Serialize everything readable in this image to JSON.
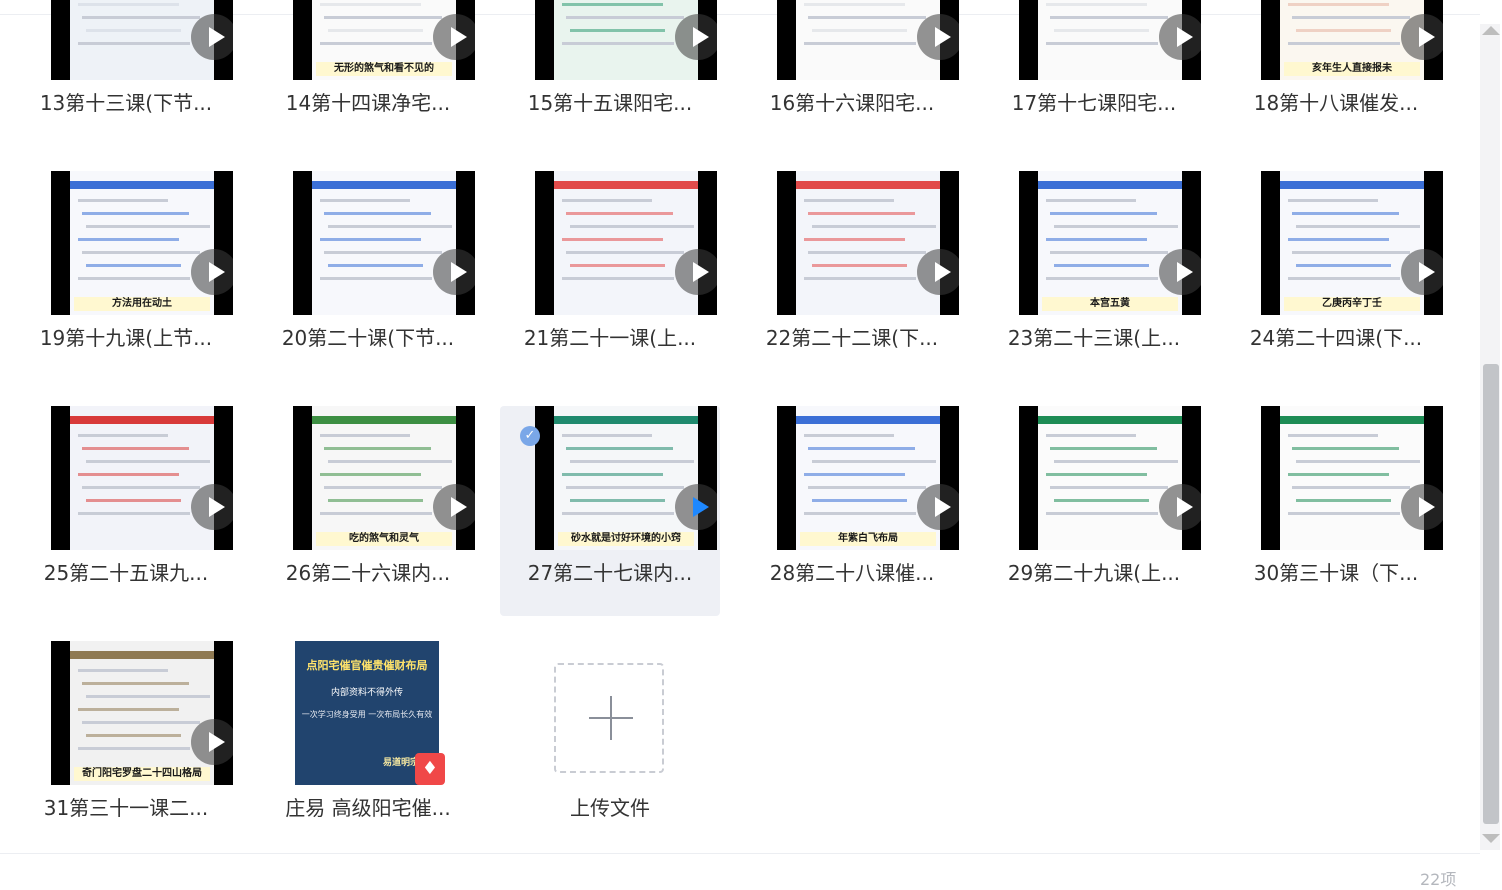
{
  "files": [
    {
      "name": "13第十三课(下节...",
      "type": "video",
      "theme": "table",
      "caption": ""
    },
    {
      "name": "14第十四课净宅...",
      "type": "video",
      "theme": "text",
      "caption": "无形的煞气和看不见的"
    },
    {
      "name": "15第十五课阳宅...",
      "type": "video",
      "theme": "textgreen",
      "caption": ""
    },
    {
      "name": "16第十六课阳宅...",
      "type": "video",
      "theme": "text",
      "caption": ""
    },
    {
      "name": "17第十七课阳宅...",
      "type": "video",
      "theme": "text",
      "caption": ""
    },
    {
      "name": "18第十八课催发...",
      "type": "video",
      "theme": "compass",
      "caption": "亥年生人直接报未"
    },
    {
      "name": "19第十九课(上节...",
      "type": "video",
      "theme": "grid",
      "caption": "方法用在动土"
    },
    {
      "name": "20第二十课(下节...",
      "type": "video",
      "theme": "grid",
      "caption": ""
    },
    {
      "name": "21第二十一课(上...",
      "type": "video",
      "theme": "colorful",
      "caption": ""
    },
    {
      "name": "22第二十二课(下...",
      "type": "video",
      "theme": "colorful",
      "caption": ""
    },
    {
      "name": "23第二十三课(上...",
      "type": "video",
      "theme": "grid",
      "caption": "本宫五黄"
    },
    {
      "name": "24第二十四课(下...",
      "type": "video",
      "theme": "grid",
      "caption": "乙庚丙辛丁壬"
    },
    {
      "name": "25第二十五课九...",
      "type": "video",
      "theme": "redgrid",
      "caption": ""
    },
    {
      "name": "26第二十六课内...",
      "type": "video",
      "theme": "qr",
      "caption": "吃的煞气和灵气"
    },
    {
      "name": "27第二十七课内...",
      "type": "video",
      "theme": "qrgreen",
      "caption": "砂水就是讨好环境的小窍",
      "selected": true
    },
    {
      "name": "28第二十八课催...",
      "type": "video",
      "theme": "grid",
      "caption": "年紫白飞布局"
    },
    {
      "name": "29第二十九课(上...",
      "type": "video",
      "theme": "greentext",
      "caption": ""
    },
    {
      "name": "30第三十课（下...",
      "type": "video",
      "theme": "greentext",
      "caption": ""
    },
    {
      "name": "31第三十一课二...",
      "type": "video",
      "theme": "luopan",
      "caption": "奇门阳宅罗盘二十四山格局"
    },
    {
      "name": "庄易 高级阳宅催...",
      "type": "pdf",
      "cover": {
        "title": "点阳宅催官催贵催财布局",
        "line1": "内部资料不得外传",
        "line2": "一次学习终身受用 一次布局长久有效",
        "line3": "易道明宗"
      }
    },
    {
      "name": "上传文件",
      "type": "upload"
    }
  ],
  "icons": {
    "play": "play-icon",
    "pdf": "pdf-icon",
    "upload": "plus-icon",
    "selected": "checkmark-icon"
  },
  "colors": {
    "selected_bg": "#eef0f5",
    "accent_play": "#1e88ff",
    "pdf_badge": "#f04848"
  },
  "footer": {
    "count_label": "22项"
  }
}
